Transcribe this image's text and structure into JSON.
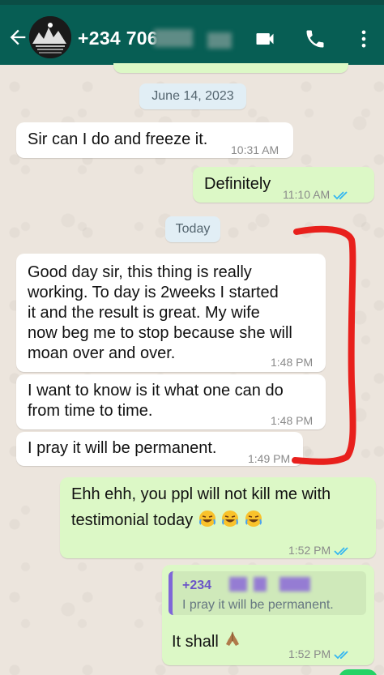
{
  "header": {
    "contact_name": "+234 706",
    "icons": [
      "back-arrow-icon",
      "video-call-icon",
      "phone-icon",
      "more-options-icon"
    ],
    "color": "#075e54"
  },
  "dates": {
    "first": "June 14, 2023",
    "second": "Today"
  },
  "messages": [
    {
      "direction": "in",
      "text": "Sir can I do and freeze it.",
      "time": "10:31 AM"
    },
    {
      "direction": "out",
      "text": "Definitely",
      "time": "11:10 AM",
      "status": "read"
    },
    {
      "direction": "in",
      "lines": [
        "Good day sir, this thing is really",
        "working. To day is 2weeks I started",
        "it and the result is great. My wife",
        "now beg me to stop because she will",
        "moan over and over."
      ],
      "time": "1:48 PM"
    },
    {
      "direction": "in",
      "lines": [
        "I want to know is it what one can do",
        "from time to time."
      ],
      "time": "1:48 PM"
    },
    {
      "direction": "in",
      "text": "I pray it will  be permanent.",
      "time": "1:49 PM"
    },
    {
      "direction": "out",
      "lines": [
        "Ehh ehh, you ppl will not kill me with",
        "testimonial today"
      ],
      "emoji": "rolling-laughing-emoji",
      "time": "1:52 PM",
      "status": "read"
    },
    {
      "direction": "out",
      "reply_to": {
        "name": "+234",
        "text": "I pray it will  be permanent."
      },
      "text": "It shall",
      "emoji": "praying-hands-emoji",
      "time": "1:52 PM",
      "status": "read"
    }
  ],
  "colors": {
    "incoming": "#ffffff",
    "outgoing": "#dcf8c6",
    "read_ticks": "#34b7f1",
    "annotation": "#e8201c"
  }
}
